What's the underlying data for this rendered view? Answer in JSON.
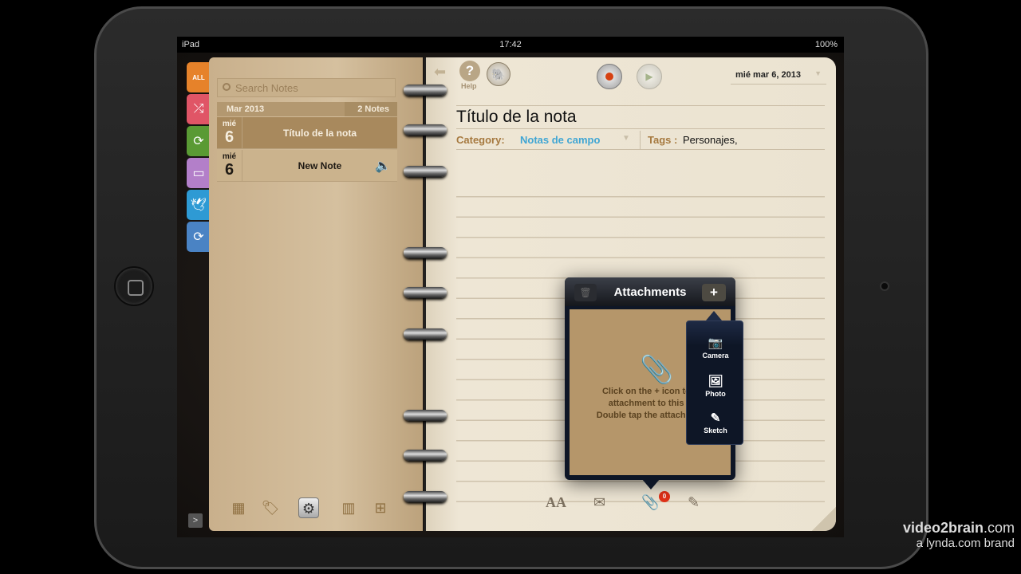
{
  "status_bar": {
    "device": "iPad",
    "time": "17:42",
    "battery": "100%"
  },
  "side_tabs": [
    {
      "name": "all-notes",
      "icon": "calendar-all-icon",
      "color": "#e6822a",
      "glyph": "ALL"
    },
    {
      "name": "shuffle",
      "icon": "shuffle-icon",
      "color": "#e05566",
      "glyph": "⤮"
    },
    {
      "name": "sync",
      "icon": "sync-icon",
      "color": "#5a9a34",
      "glyph": "⟳"
    },
    {
      "name": "display",
      "icon": "monitor-icon",
      "color": "#b37fc9",
      "glyph": "▭"
    },
    {
      "name": "bird",
      "icon": "bird-icon",
      "color": "#2e9ad4",
      "glyph": "🕊"
    },
    {
      "name": "refresh",
      "icon": "refresh-icon",
      "color": "#4a83c4",
      "glyph": "⟳"
    }
  ],
  "notes_list": {
    "search_placeholder": "Search Notes",
    "month": "Mar 2013",
    "count": "2 Notes",
    "notes": [
      {
        "dow": "mié",
        "day": "6",
        "title": "Título de la nota",
        "selected": true
      },
      {
        "dow": "mié",
        "day": "6",
        "title": "New Note",
        "selected": false,
        "has_audio": true
      }
    ]
  },
  "left_toolbar": [
    "calendar-icon",
    "tag-icon",
    "gear-icon",
    "trash-icon",
    "add-note-icon"
  ],
  "note": {
    "help_label": "Help",
    "date": "mié mar 6, 2013",
    "title": "Título de la nota",
    "category_label": "Category:",
    "category_value": "Notas de campo",
    "tags_label": "Tags",
    "tags_sep": ":",
    "tags_value": "Personajes,"
  },
  "attachments": {
    "title": "Attachments",
    "count_badge": "0",
    "hint": "Click on the + icon to a\nattachment to this n\nDouble tap the attachmen",
    "menu": [
      {
        "label": "Camera",
        "icon": "camera-icon"
      },
      {
        "label": "Photo",
        "icon": "photo-icon"
      },
      {
        "label": "Sketch",
        "icon": "pencil-icon"
      }
    ]
  },
  "watermark": {
    "brand": "video2brain",
    "domain": ".com",
    "tagline": "a lynda.com brand"
  }
}
